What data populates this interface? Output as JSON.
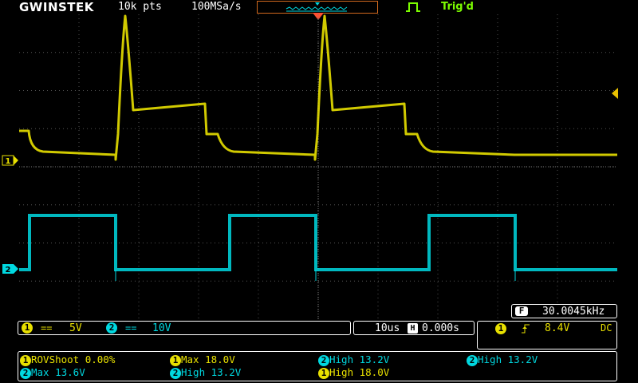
{
  "header": {
    "brand": "GWINSTEK",
    "record_length": "10k pts",
    "sample_rate": "100MSa/s",
    "trigger_status": "Trig'd"
  },
  "frequency_counter": {
    "label": "F",
    "value": "30.0045kHz"
  },
  "channels": [
    {
      "number": "1",
      "coupling_symbol": "==",
      "scale": "5V",
      "color": "#e8e000"
    },
    {
      "number": "2",
      "coupling_symbol": "==",
      "scale": "10V",
      "color": "#00d8e0"
    }
  ],
  "timebase": {
    "scale": "10us",
    "position_symbol": "H",
    "position": "0.000s"
  },
  "trigger": {
    "channel": "1",
    "slope_icon": "rising-edge-icon",
    "level": "8.4V",
    "coupling": "DC"
  },
  "measurements": [
    {
      "ch": "1",
      "text": "ROVShoot 0.00%"
    },
    {
      "ch": "1",
      "text": "Max 18.0V"
    },
    {
      "ch": "2",
      "text": "High 13.2V"
    },
    {
      "ch": "2",
      "text": "High 13.2V"
    },
    {
      "ch": "2",
      "text": "Max 13.6V"
    },
    {
      "ch": "2",
      "text": "High 13.2V"
    },
    {
      "ch": "1",
      "text": "High 18.0V"
    }
  ]
}
